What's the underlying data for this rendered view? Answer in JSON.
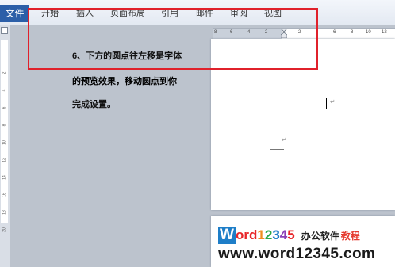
{
  "ribbon": {
    "file_tab": "文件",
    "tabs": [
      "开始",
      "插入",
      "页面布局",
      "引用",
      "邮件",
      "审阅",
      "视图"
    ]
  },
  "ruler": {
    "horizontal_numbers": [
      "8",
      "6",
      "4",
      "2",
      "2",
      "4",
      "6",
      "8",
      "10",
      "12"
    ],
    "vertical_numbers": [
      "2",
      "4",
      "6",
      "8",
      "10",
      "12",
      "14",
      "16",
      "18",
      "20"
    ]
  },
  "document": {
    "line1": "6、下方的圆点往左移是字体",
    "line2": "的预览效果，移动圆点到你",
    "line3": "完成设置。"
  },
  "watermark": {
    "logo_letter": "W",
    "logo_text_parts": [
      "ord",
      "1",
      "2",
      "3",
      "4",
      "5"
    ],
    "tagline_part1": "办公软件",
    "tagline_part2": "教程",
    "url": "www.word12345.com"
  },
  "colors": {
    "file_tab": "#2c5fa8",
    "highlight_box": "#e0212b",
    "logo_parts": [
      "#1e7ec8",
      "#e8262a",
      "#f08c1e",
      "#2aa84a",
      "#1e7ec8",
      "#8a3fb8"
    ],
    "tagline_part2": "#e53b2f"
  }
}
